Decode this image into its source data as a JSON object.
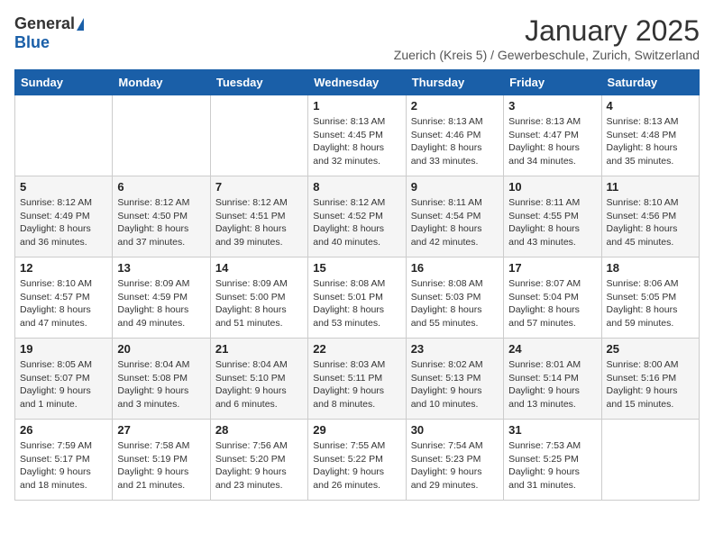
{
  "logo": {
    "general": "General",
    "blue": "Blue"
  },
  "header": {
    "month": "January 2025",
    "subtitle": "Zuerich (Kreis 5) / Gewerbeschule, Zurich, Switzerland"
  },
  "weekdays": [
    "Sunday",
    "Monday",
    "Tuesday",
    "Wednesday",
    "Thursday",
    "Friday",
    "Saturday"
  ],
  "weeks": [
    [
      {
        "day": "",
        "info": ""
      },
      {
        "day": "",
        "info": ""
      },
      {
        "day": "",
        "info": ""
      },
      {
        "day": "1",
        "info": "Sunrise: 8:13 AM\nSunset: 4:45 PM\nDaylight: 8 hours\nand 32 minutes."
      },
      {
        "day": "2",
        "info": "Sunrise: 8:13 AM\nSunset: 4:46 PM\nDaylight: 8 hours\nand 33 minutes."
      },
      {
        "day": "3",
        "info": "Sunrise: 8:13 AM\nSunset: 4:47 PM\nDaylight: 8 hours\nand 34 minutes."
      },
      {
        "day": "4",
        "info": "Sunrise: 8:13 AM\nSunset: 4:48 PM\nDaylight: 8 hours\nand 35 minutes."
      }
    ],
    [
      {
        "day": "5",
        "info": "Sunrise: 8:12 AM\nSunset: 4:49 PM\nDaylight: 8 hours\nand 36 minutes."
      },
      {
        "day": "6",
        "info": "Sunrise: 8:12 AM\nSunset: 4:50 PM\nDaylight: 8 hours\nand 37 minutes."
      },
      {
        "day": "7",
        "info": "Sunrise: 8:12 AM\nSunset: 4:51 PM\nDaylight: 8 hours\nand 39 minutes."
      },
      {
        "day": "8",
        "info": "Sunrise: 8:12 AM\nSunset: 4:52 PM\nDaylight: 8 hours\nand 40 minutes."
      },
      {
        "day": "9",
        "info": "Sunrise: 8:11 AM\nSunset: 4:54 PM\nDaylight: 8 hours\nand 42 minutes."
      },
      {
        "day": "10",
        "info": "Sunrise: 8:11 AM\nSunset: 4:55 PM\nDaylight: 8 hours\nand 43 minutes."
      },
      {
        "day": "11",
        "info": "Sunrise: 8:10 AM\nSunset: 4:56 PM\nDaylight: 8 hours\nand 45 minutes."
      }
    ],
    [
      {
        "day": "12",
        "info": "Sunrise: 8:10 AM\nSunset: 4:57 PM\nDaylight: 8 hours\nand 47 minutes."
      },
      {
        "day": "13",
        "info": "Sunrise: 8:09 AM\nSunset: 4:59 PM\nDaylight: 8 hours\nand 49 minutes."
      },
      {
        "day": "14",
        "info": "Sunrise: 8:09 AM\nSunset: 5:00 PM\nDaylight: 8 hours\nand 51 minutes."
      },
      {
        "day": "15",
        "info": "Sunrise: 8:08 AM\nSunset: 5:01 PM\nDaylight: 8 hours\nand 53 minutes."
      },
      {
        "day": "16",
        "info": "Sunrise: 8:08 AM\nSunset: 5:03 PM\nDaylight: 8 hours\nand 55 minutes."
      },
      {
        "day": "17",
        "info": "Sunrise: 8:07 AM\nSunset: 5:04 PM\nDaylight: 8 hours\nand 57 minutes."
      },
      {
        "day": "18",
        "info": "Sunrise: 8:06 AM\nSunset: 5:05 PM\nDaylight: 8 hours\nand 59 minutes."
      }
    ],
    [
      {
        "day": "19",
        "info": "Sunrise: 8:05 AM\nSunset: 5:07 PM\nDaylight: 9 hours\nand 1 minute."
      },
      {
        "day": "20",
        "info": "Sunrise: 8:04 AM\nSunset: 5:08 PM\nDaylight: 9 hours\nand 3 minutes."
      },
      {
        "day": "21",
        "info": "Sunrise: 8:04 AM\nSunset: 5:10 PM\nDaylight: 9 hours\nand 6 minutes."
      },
      {
        "day": "22",
        "info": "Sunrise: 8:03 AM\nSunset: 5:11 PM\nDaylight: 9 hours\nand 8 minutes."
      },
      {
        "day": "23",
        "info": "Sunrise: 8:02 AM\nSunset: 5:13 PM\nDaylight: 9 hours\nand 10 minutes."
      },
      {
        "day": "24",
        "info": "Sunrise: 8:01 AM\nSunset: 5:14 PM\nDaylight: 9 hours\nand 13 minutes."
      },
      {
        "day": "25",
        "info": "Sunrise: 8:00 AM\nSunset: 5:16 PM\nDaylight: 9 hours\nand 15 minutes."
      }
    ],
    [
      {
        "day": "26",
        "info": "Sunrise: 7:59 AM\nSunset: 5:17 PM\nDaylight: 9 hours\nand 18 minutes."
      },
      {
        "day": "27",
        "info": "Sunrise: 7:58 AM\nSunset: 5:19 PM\nDaylight: 9 hours\nand 21 minutes."
      },
      {
        "day": "28",
        "info": "Sunrise: 7:56 AM\nSunset: 5:20 PM\nDaylight: 9 hours\nand 23 minutes."
      },
      {
        "day": "29",
        "info": "Sunrise: 7:55 AM\nSunset: 5:22 PM\nDaylight: 9 hours\nand 26 minutes."
      },
      {
        "day": "30",
        "info": "Sunrise: 7:54 AM\nSunset: 5:23 PM\nDaylight: 9 hours\nand 29 minutes."
      },
      {
        "day": "31",
        "info": "Sunrise: 7:53 AM\nSunset: 5:25 PM\nDaylight: 9 hours\nand 31 minutes."
      },
      {
        "day": "",
        "info": ""
      }
    ]
  ]
}
